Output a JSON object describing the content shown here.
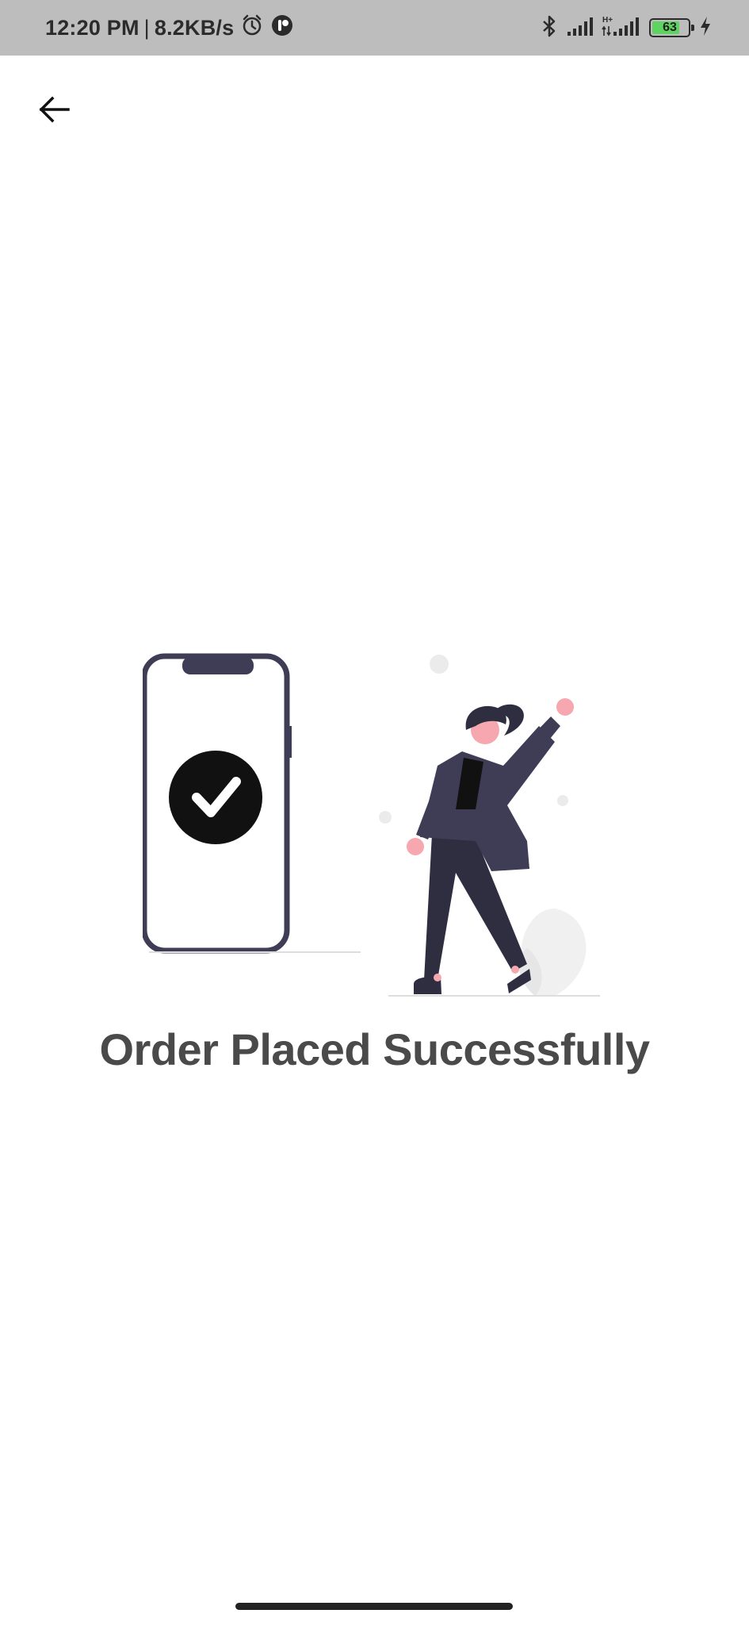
{
  "status_bar": {
    "time": "12:20 PM",
    "separator": "|",
    "network_speed": "8.2KB/s",
    "battery_level": "63",
    "icons": [
      "alarm-icon",
      "app-notification-icon",
      "bluetooth-icon",
      "signal-icon",
      "hplus-signal-icon",
      "battery-icon",
      "charging-icon"
    ]
  },
  "toolbar": {
    "back_icon": "arrow-left-icon"
  },
  "main": {
    "title": "Order Placed Successfully"
  },
  "colors": {
    "status_bar_bg": "#bdbdbd",
    "illustration_dark": "#3f3d56",
    "illustration_skin": "#f7a7b0",
    "title_text": "#4a4a4a",
    "battery_fill": "#5fd35f"
  }
}
